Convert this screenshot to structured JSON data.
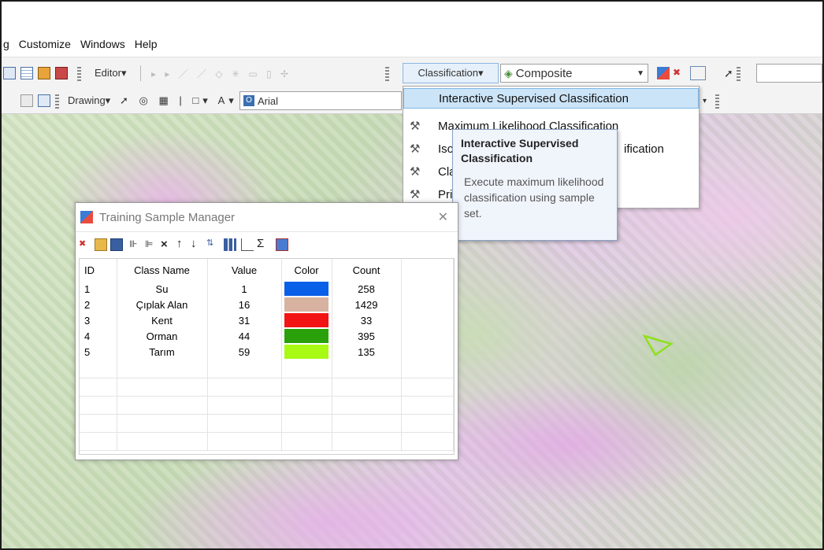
{
  "menubar": {
    "items": [
      "g",
      "Customize",
      "Windows",
      "Help"
    ]
  },
  "toolbar1": {
    "editor_label": "Editor▾",
    "classification_label": "Classification▾",
    "layer_combo_value": "Composite"
  },
  "toolbar2": {
    "drawing_label": "Drawing▾",
    "font_combo_value": "Arial"
  },
  "classification_menu": {
    "items": [
      "Interactive Supervised Classification",
      "Maximum Likelihood Classification",
      "Iso",
      "Cla",
      "Pri"
    ],
    "iso_suffix": "ification"
  },
  "tooltip": {
    "title": "Interactive Supervised Classification",
    "body": "Execute maximum likelihood classification using sample set."
  },
  "training_manager": {
    "title": "Training Sample Manager",
    "columns": [
      "ID",
      "Class Name",
      "Value",
      "Color",
      "Count"
    ],
    "rows": [
      {
        "id": "1",
        "name": "Su",
        "value": "1",
        "color": "#0a5fe8",
        "count": "258"
      },
      {
        "id": "2",
        "name": "Çıplak Alan",
        "value": "16",
        "color": "#d7b2a0",
        "count": "1429"
      },
      {
        "id": "3",
        "name": "Kent",
        "value": "31",
        "color": "#f21414",
        "count": "33"
      },
      {
        "id": "4",
        "name": "Orman",
        "value": "44",
        "color": "#2aa10a",
        "count": "395"
      },
      {
        "id": "5",
        "name": "Tarım",
        "value": "59",
        "color": "#a8fa14",
        "count": "135"
      }
    ]
  },
  "colors": {
    "menu_highlight": "#cce4f7",
    "tooltip_bg": "#f0f4fb"
  }
}
